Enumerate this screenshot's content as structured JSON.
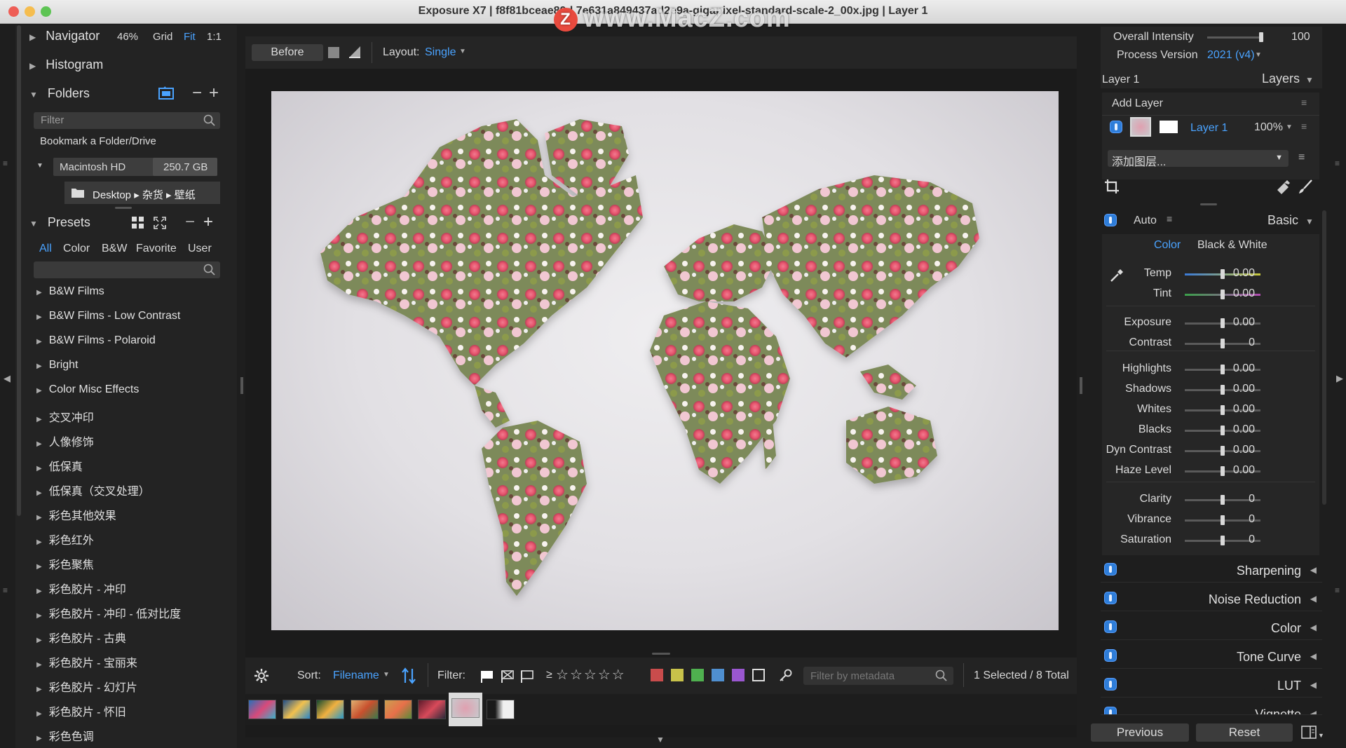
{
  "title": "Exposure X7 | f8f81bceae89d.7e631a849437ad2e9a-gigapixel-standard-scale-2_00x.jpg | Layer 1",
  "watermark": {
    "logo": "Z",
    "text": "www.MacZ.com"
  },
  "navigator": {
    "label": "Navigator",
    "zoom": "46%",
    "grid": "Grid",
    "fit": "Fit",
    "one_to_one": "1:1"
  },
  "histogram": {
    "label": "Histogram"
  },
  "folders": {
    "label": "Folders",
    "filter_placeholder": "Filter",
    "bookmark": "Bookmark a Folder/Drive",
    "drive": {
      "name": "Macintosh HD",
      "size": "250.7 GB"
    },
    "path": "Desktop ▸ 杂货 ▸ 壁纸"
  },
  "presets": {
    "label": "Presets",
    "tabs": [
      "All",
      "Color",
      "B&W",
      "Favorite",
      "User"
    ],
    "items": [
      "B&W Films",
      "B&W Films - Low Contrast",
      "B&W Films - Polaroid",
      "Bright",
      "Color Misc Effects",
      "交叉冲印",
      "人像修饰",
      "低保真",
      "低保真（交叉处理）",
      "彩色其他效果",
      "彩色红外",
      "彩色聚焦",
      "彩色胶片 - 冲印",
      "彩色胶片 - 冲印 - 低对比度",
      "彩色胶片 - 古典",
      "彩色胶片 - 宝丽来",
      "彩色胶片 - 幻灯片",
      "彩色胶片 - 怀旧",
      "彩色色调"
    ]
  },
  "toolbar": {
    "before": "Before",
    "layout_label": "Layout:",
    "layout_value": "Single"
  },
  "bottombar": {
    "sort_label": "Sort:",
    "sort_value": "Filename",
    "filter_label": "Filter:",
    "ge": "≥",
    "metadata_placeholder": "Filter by metadata",
    "selection": "1 Selected / 8 Total",
    "color_labels": [
      "#c94c4c",
      "#c8c24a",
      "#4fb04f",
      "#4f8fd0",
      "#9a57d0"
    ]
  },
  "right": {
    "overall_intensity": {
      "label": "Overall Intensity",
      "value": "100",
      "level": 1.0
    },
    "process_version": {
      "label": "Process Version",
      "value": "2021 (v4)"
    },
    "layer_title": "Layer 1",
    "layers_label": "Layers",
    "add_layer": "Add Layer",
    "layer_name": "Layer 1",
    "layer_opacity": "100%",
    "add_layer_select": "添加图层...",
    "auto": "Auto",
    "basic": "Basic",
    "mode_color": "Color",
    "mode_bw": "Black & White",
    "adjustments": [
      {
        "label": "Temp",
        "value": "0.00"
      },
      {
        "label": "Tint",
        "value": "0.00"
      },
      {
        "label": "Exposure",
        "value": "0.00"
      },
      {
        "label": "Contrast",
        "value": "0"
      },
      {
        "label": "Highlights",
        "value": "0.00"
      },
      {
        "label": "Shadows",
        "value": "0.00"
      },
      {
        "label": "Whites",
        "value": "0.00"
      },
      {
        "label": "Blacks",
        "value": "0.00"
      },
      {
        "label": "Dyn Contrast",
        "value": "0.00"
      },
      {
        "label": "Haze Level",
        "value": "0.00"
      },
      {
        "label": "Clarity",
        "value": "0"
      },
      {
        "label": "Vibrance",
        "value": "0"
      },
      {
        "label": "Saturation",
        "value": "0"
      }
    ],
    "sections": [
      "Sharpening",
      "Noise Reduction",
      "Color",
      "Tone Curve",
      "LUT",
      "Vignette"
    ],
    "previous": "Previous",
    "reset": "Reset"
  }
}
